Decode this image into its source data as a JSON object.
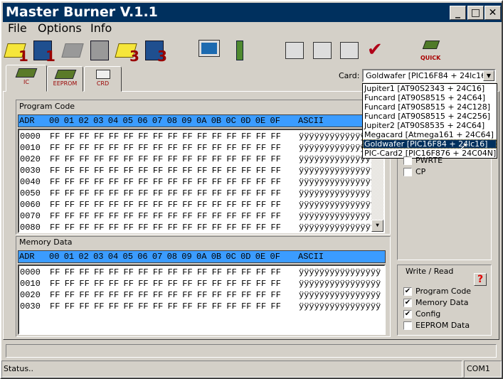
{
  "window": {
    "title": "Master Burner V.1.1",
    "minimize": "_",
    "maximize": "□",
    "close": "✕"
  },
  "menu": [
    "File",
    "Options",
    "Info"
  ],
  "toolbar": [
    {
      "icon": "open-folder-1-icon",
      "badge": "1",
      "enabled": true
    },
    {
      "icon": "save-disk-1-icon",
      "badge": "1",
      "enabled": true
    },
    {
      "icon": "open-folder-2-icon",
      "badge": "",
      "enabled": false
    },
    {
      "icon": "save-disk-2-icon",
      "badge": "",
      "enabled": false
    },
    {
      "icon": "open-folder-3-icon",
      "badge": "3",
      "enabled": true
    },
    {
      "icon": "save-disk-3-icon",
      "badge": "3",
      "enabled": true
    },
    {
      "icon": "computer-icon",
      "badge": "",
      "enabled": true
    },
    {
      "icon": "info-icon",
      "badge": "",
      "enabled": true
    },
    {
      "icon": "write-icon",
      "badge": "",
      "enabled": true
    },
    {
      "icon": "read-chip-icon",
      "badge": "",
      "enabled": true
    },
    {
      "icon": "erase-brush-icon",
      "badge": "",
      "enabled": true
    },
    {
      "icon": "verify-check-icon",
      "badge": "",
      "enabled": true
    },
    {
      "icon": "quick-icon",
      "badge": "QUICK",
      "enabled": true
    }
  ],
  "tabs": [
    {
      "label": "IC",
      "active": true
    },
    {
      "label": "EEPROM",
      "active": false
    },
    {
      "label": "CRD",
      "active": false
    }
  ],
  "card": {
    "label": "Card:",
    "value": "Goldwafer [PIC16F84 + 24lc16]",
    "options": [
      "Jupiter1 [AT90S2343 + 24C16]",
      "Funcard [AT90S8515 + 24C64]",
      "Funcard [AT90S8515 + 24C128]",
      "Funcard [AT90S8515 + 24C256]",
      "Jupiter2 [AT90S8535 + 24C64]",
      "Megacard [Atmega161 + 24C64]",
      "Goldwafer [PIC16F84 + 24lc16]",
      "PIC-Card2 [PIC16F876 + 24C04N]"
    ],
    "selected_index": 6
  },
  "program_code": {
    "label": "Program Code",
    "columns": [
      "ADR",
      "00",
      "01",
      "02",
      "03",
      "04",
      "05",
      "06",
      "07",
      "08",
      "09",
      "0A",
      "0B",
      "0C",
      "0D",
      "0E",
      "0F",
      "ASCII"
    ],
    "rows": [
      {
        "adr": "0000",
        "bytes": "FF",
        "ascii": "ÿÿÿÿÿÿÿÿÿÿÿÿÿÿÿÿ"
      },
      {
        "adr": "0010",
        "bytes": "FF",
        "ascii": "ÿÿÿÿÿÿÿÿÿÿÿÿÿÿÿÿ"
      },
      {
        "adr": "0020",
        "bytes": "FF",
        "ascii": "ÿÿÿÿÿÿÿÿÿÿÿÿÿÿÿÿ"
      },
      {
        "adr": "0030",
        "bytes": "FF",
        "ascii": "ÿÿÿÿÿÿÿÿÿÿÿÿÿÿÿÿ"
      },
      {
        "adr": "0040",
        "bytes": "FF",
        "ascii": "ÿÿÿÿÿÿÿÿÿÿÿÿÿÿÿÿ"
      },
      {
        "adr": "0050",
        "bytes": "FF",
        "ascii": "ÿÿÿÿÿÿÿÿÿÿÿÿÿÿÿÿ"
      },
      {
        "adr": "0060",
        "bytes": "FF",
        "ascii": "ÿÿÿÿÿÿÿÿÿÿÿÿÿÿÿÿ"
      },
      {
        "adr": "0070",
        "bytes": "FF",
        "ascii": "ÿÿÿÿÿÿÿÿÿÿÿÿÿÿÿÿ"
      },
      {
        "adr": "0080",
        "bytes": "FF",
        "ascii": "ÿÿÿÿÿÿÿÿÿÿÿÿÿÿÿÿ"
      }
    ]
  },
  "memory_data": {
    "label": "Memory Data",
    "columns": [
      "ADR",
      "00",
      "01",
      "02",
      "03",
      "04",
      "05",
      "06",
      "07",
      "08",
      "09",
      "0A",
      "0B",
      "0C",
      "0D",
      "0E",
      "0F",
      "ASCII"
    ],
    "rows": [
      {
        "adr": "0000",
        "bytes": "FF",
        "ascii": "ÿÿÿÿÿÿÿÿÿÿÿÿÿÿÿÿ"
      },
      {
        "adr": "0010",
        "bytes": "FF",
        "ascii": "ÿÿÿÿÿÿÿÿÿÿÿÿÿÿÿÿ"
      },
      {
        "adr": "0020",
        "bytes": "FF",
        "ascii": "ÿÿÿÿÿÿÿÿÿÿÿÿÿÿÿÿ"
      },
      {
        "adr": "0030",
        "bytes": "FF",
        "ascii": "ÿÿÿÿÿÿÿÿÿÿÿÿÿÿÿÿ"
      }
    ]
  },
  "config": {
    "options": [
      {
        "label": "PWRTE",
        "checked": false
      },
      {
        "label": "CP",
        "checked": false
      }
    ]
  },
  "write_read": {
    "label": "Write / Read",
    "help": "?",
    "options": [
      {
        "label": "Program Code",
        "checked": true
      },
      {
        "label": "Memory Data",
        "checked": true
      },
      {
        "label": "Config",
        "checked": true
      },
      {
        "label": "EEPROM Data",
        "checked": false
      }
    ]
  },
  "status": {
    "text": "Status..",
    "port": "COM1",
    "progress": 0
  },
  "colors": {
    "title_bar": "#00305e",
    "hex_header": "#3b9cff",
    "tab_label": "#990000"
  }
}
